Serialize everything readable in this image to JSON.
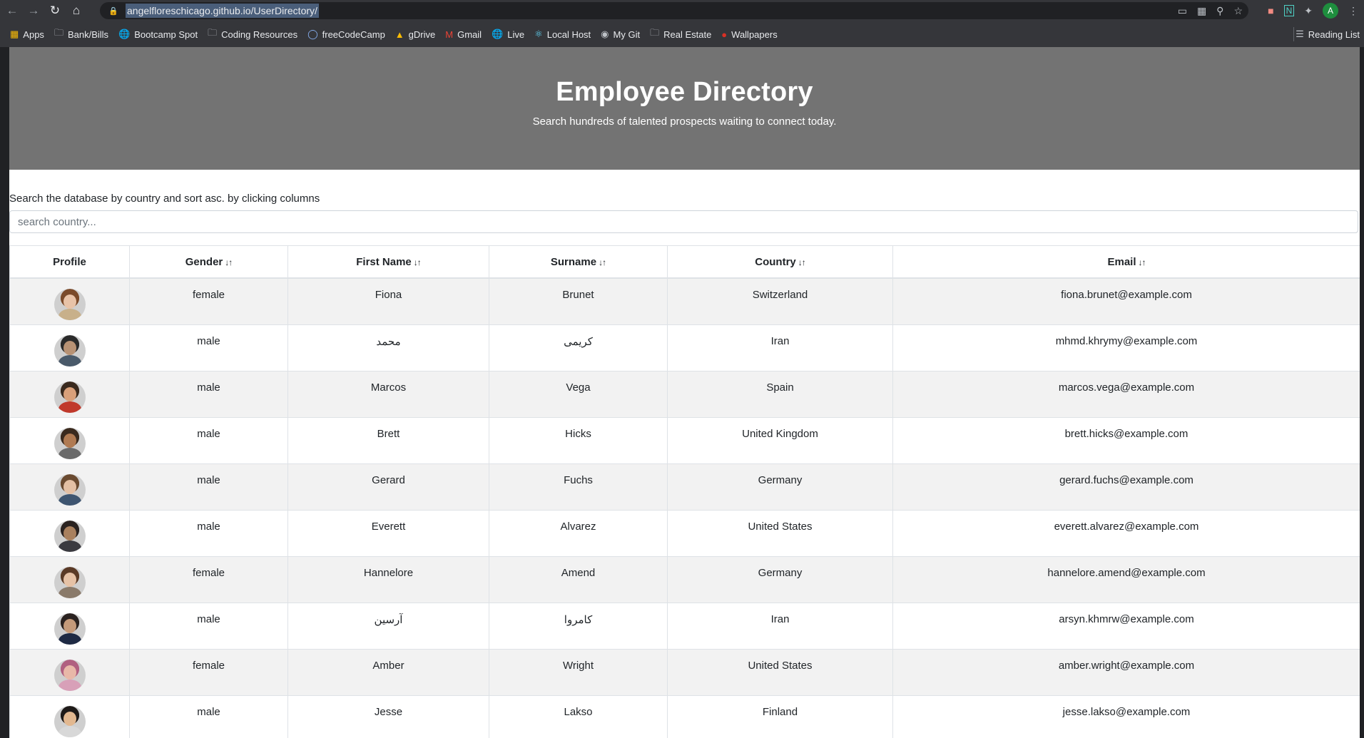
{
  "browser": {
    "url": "angelfloreschicago.github.io/UserDirectory/",
    "profile_initial": "A",
    "bookmarks": [
      {
        "label": "Apps",
        "icon": "apps-grid-icon"
      },
      {
        "label": "Bank/Bills",
        "icon": "folder-icon"
      },
      {
        "label": "Bootcamp Spot",
        "icon": "globe-icon"
      },
      {
        "label": "Coding Resources",
        "icon": "folder-icon"
      },
      {
        "label": "freeCodeCamp",
        "icon": "freecodecamp-icon"
      },
      {
        "label": "gDrive",
        "icon": "google-drive-icon"
      },
      {
        "label": "Gmail",
        "icon": "gmail-icon"
      },
      {
        "label": "Live",
        "icon": "globe-icon"
      },
      {
        "label": "Local Host",
        "icon": "react-icon"
      },
      {
        "label": "My Git",
        "icon": "github-icon"
      },
      {
        "label": "Real Estate",
        "icon": "folder-icon"
      },
      {
        "label": "Wallpapers",
        "icon": "red-circle-icon"
      }
    ],
    "reading_list": "Reading List"
  },
  "header": {
    "title": "Employee Directory",
    "subtitle": "Search hundreds of talented prospects waiting to connect today."
  },
  "search": {
    "hint": "Search the database by country and sort asc. by clicking columns",
    "placeholder": "search country..."
  },
  "table": {
    "columns": [
      "Profile",
      "Gender",
      "First Name",
      "Surname",
      "Country",
      "Email"
    ],
    "rows": [
      {
        "gender": "female",
        "first": "Fiona",
        "last": "Brunet",
        "country": "Switzerland",
        "email": "fiona.brunet@example.com",
        "skin": "#e8c3a8",
        "hair": "#7a4a2a",
        "shirt": "#c8b08a"
      },
      {
        "gender": "male",
        "first": "محمد",
        "last": "کریمی",
        "country": "Iran",
        "email": "mhmd.khrymy@example.com",
        "skin": "#b89274",
        "hair": "#2a2a2a",
        "shirt": "#4a5a6a"
      },
      {
        "gender": "male",
        "first": "Marcos",
        "last": "Vega",
        "country": "Spain",
        "email": "marcos.vega@example.com",
        "skin": "#d9a07a",
        "hair": "#3a2a1e",
        "shirt": "#c0392b"
      },
      {
        "gender": "male",
        "first": "Brett",
        "last": "Hicks",
        "country": "United Kingdom",
        "email": "brett.hicks@example.com",
        "skin": "#b07a52",
        "hair": "#3a2a1e",
        "shirt": "#6a6a6a"
      },
      {
        "gender": "male",
        "first": "Gerard",
        "last": "Fuchs",
        "country": "Germany",
        "email": "gerard.fuchs@example.com",
        "skin": "#e4c0a4",
        "hair": "#6a4a30",
        "shirt": "#3e5570"
      },
      {
        "gender": "male",
        "first": "Everett",
        "last": "Alvarez",
        "country": "United States",
        "email": "everett.alvarez@example.com",
        "skin": "#a9805e",
        "hair": "#2a2220",
        "shirt": "#3a3a40"
      },
      {
        "gender": "female",
        "first": "Hannelore",
        "last": "Amend",
        "country": "Germany",
        "email": "hannelore.amend@example.com",
        "skin": "#e6c2a6",
        "hair": "#5a3a26",
        "shirt": "#8a7a6a"
      },
      {
        "gender": "male",
        "first": "آرسین",
        "last": "کامروا",
        "country": "Iran",
        "email": "arsyn.khmrw@example.com",
        "skin": "#c49a7a",
        "hair": "#2a2220",
        "shirt": "#1e2a44"
      },
      {
        "gender": "female",
        "first": "Amber",
        "last": "Wright",
        "country": "United States",
        "email": "amber.wright@example.com",
        "skin": "#e8b8a8",
        "hair": "#b06080",
        "shirt": "#d8a0b8"
      },
      {
        "gender": "male",
        "first": "Jesse",
        "last": "Lakso",
        "country": "Finland",
        "email": "jesse.lakso@example.com",
        "skin": "#e2b890",
        "hair": "#1e1a18",
        "shirt": "#d8d8d8"
      }
    ]
  }
}
